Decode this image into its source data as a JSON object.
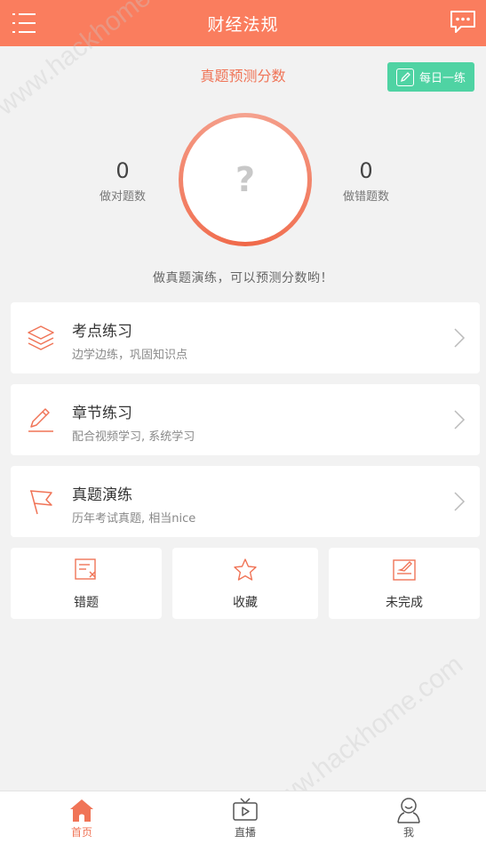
{
  "header": {
    "title": "财经法规"
  },
  "prediction": {
    "title": "真题预测分数",
    "daily_button": "每日一练",
    "score": "?",
    "correct_count": "0",
    "correct_label": "做对题数",
    "wrong_count": "0",
    "wrong_label": "做错题数",
    "hint": "做真题演练，可以预测分数哟！"
  },
  "cards": [
    {
      "title": "考点练习",
      "subtitle": "边学边练，巩固知识点",
      "icon": "layers-icon"
    },
    {
      "title": "章节练习",
      "subtitle": "配合视频学习, 系统学习",
      "icon": "pencil-icon"
    },
    {
      "title": "真题演练",
      "subtitle": "历年考试真题, 相当nice",
      "icon": "flag-icon"
    }
  ],
  "tiles": [
    {
      "label": "错题",
      "icon": "wrong-list-icon"
    },
    {
      "label": "收藏",
      "icon": "star-icon"
    },
    {
      "label": "未完成",
      "icon": "unfinished-icon"
    }
  ],
  "tabbar": {
    "items": [
      {
        "label": "首页",
        "icon": "home-icon",
        "active": true
      },
      {
        "label": "直播",
        "icon": "tv-icon",
        "active": false
      },
      {
        "label": "我",
        "icon": "user-icon",
        "active": false
      }
    ]
  },
  "watermark": "www.hackhome.com",
  "colors": {
    "accent": "#fa7d5e",
    "daily_button": "#4fd3a3",
    "background": "#f2f2f2"
  }
}
